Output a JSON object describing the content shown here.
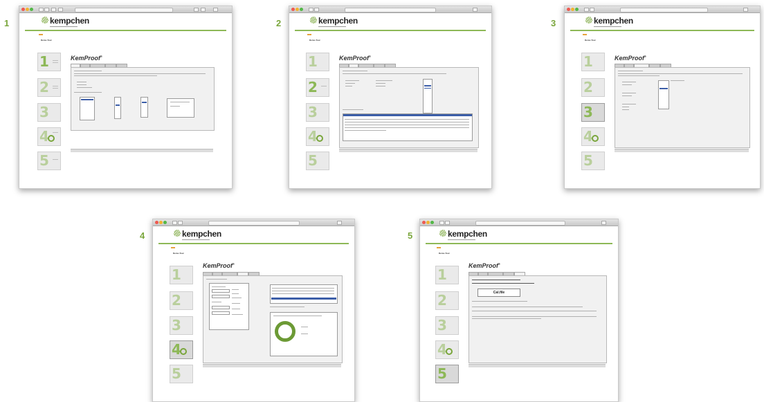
{
  "panels": [
    {
      "number": "1",
      "active_step": 1,
      "active_tab": 1
    },
    {
      "number": "2",
      "active_step": 2,
      "active_tab": 2
    },
    {
      "number": "3",
      "active_step": 3,
      "active_tab": 3
    },
    {
      "number": "4",
      "active_step": 4,
      "active_tab": 4
    },
    {
      "number": "5",
      "active_step": 5,
      "active_tab": 5
    }
  ],
  "brand": {
    "logo_text": "kempchen",
    "product": "KemProof",
    "accent_color": "#7aa63c",
    "highlight_color": "#e6a23c"
  },
  "nav": {
    "demo_label": "Demo-Tour"
  },
  "panel5": {
    "button_label": "Cal.file"
  },
  "icons": [
    "browser-close-dot",
    "browser-minimize-dot",
    "browser-maximize-dot",
    "kempchen-logo-icon",
    "donut-chart-icon"
  ]
}
